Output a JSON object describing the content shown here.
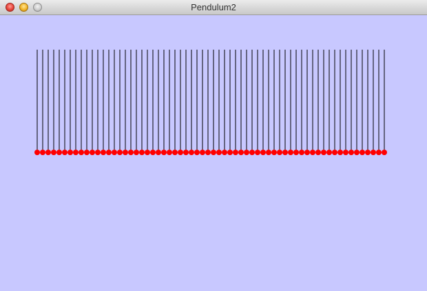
{
  "window": {
    "title": "Pendulum2"
  },
  "colors": {
    "canvas_background": "#c8c8ff",
    "string": "#000000",
    "bob": "#ff0000"
  },
  "simulation": {
    "pendulum_count": 64
  }
}
